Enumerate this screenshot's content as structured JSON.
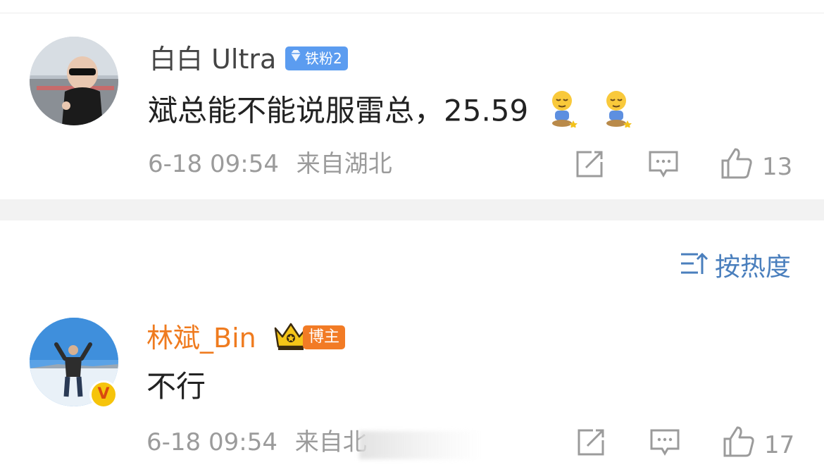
{
  "comments": [
    {
      "username": "白白 Ultra",
      "badge": "铁粉2",
      "text": "斌总能不能说服雷总，25.59",
      "timestamp": "6-18 09:54",
      "location": "来自湖北",
      "likes": "13",
      "emoji": "face-sleepy-sitting"
    },
    {
      "username": "林斌_Bin",
      "badge": "博主",
      "text": "不行",
      "timestamp": "6-18 09:54",
      "location": "来自北",
      "likes": "17",
      "verified": "V"
    }
  ],
  "sort": {
    "label": "按热度"
  },
  "colors": {
    "accent_blue": "#4a7fbd",
    "badge_blue": "#5b9cf0",
    "orange": "#ef7b1f",
    "meta_gray": "#9b9b9b"
  }
}
